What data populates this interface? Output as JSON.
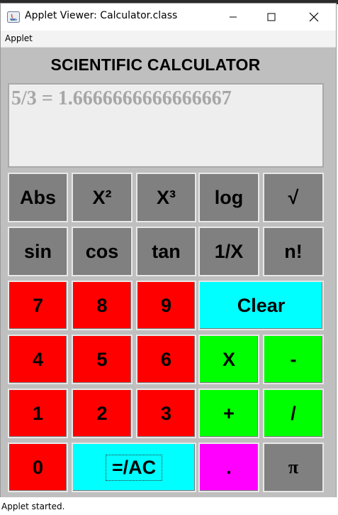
{
  "window": {
    "title": "Applet Viewer: Calculator.class",
    "menu": [
      "Applet"
    ]
  },
  "calculator": {
    "heading": "SCIENTIFIC CALCULATOR",
    "display": "5/3 = 1.6666666666666667",
    "rows": [
      [
        "Abs",
        "X²",
        "X³",
        "log",
        "√"
      ],
      [
        "sin",
        "cos",
        "tan",
        "1/X",
        "n!"
      ],
      [
        "7",
        "8",
        "9",
        "Clear"
      ],
      [
        "4",
        "5",
        "6",
        "X",
        "-"
      ],
      [
        "1",
        "2",
        "3",
        "+",
        "/"
      ],
      [
        "0",
        "=/AC",
        ".",
        "π"
      ]
    ]
  },
  "status": "Applet started.",
  "colors": {
    "function_button": "#808080",
    "digit_button": "#ff0000",
    "clear_button": "#00ffff",
    "operator_button": "#00ff00",
    "decimal_button": "#ff00ff",
    "panel_background": "#bfbfbf",
    "display_text": "#a7a7a7"
  },
  "icons": [
    "java-applet-icon",
    "minimize-icon",
    "maximize-icon",
    "close-icon"
  ]
}
